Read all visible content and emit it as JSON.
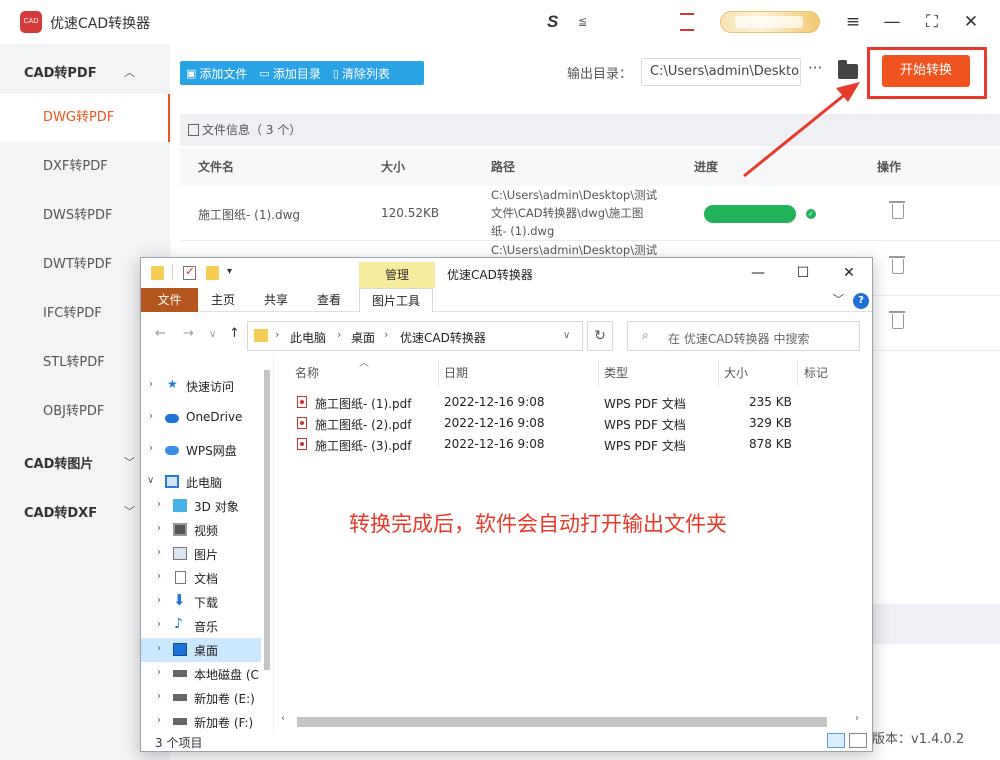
{
  "app": {
    "title": "优速CAD转换器",
    "logo_text": "CAD",
    "titlebar_mini": "≦"
  },
  "window_controls": {
    "menu": "≡",
    "minimize": "—",
    "maximize": "⛶",
    "close": "✕"
  },
  "sidebar": {
    "groups": [
      {
        "label": "CAD转PDF",
        "expanded": true
      },
      {
        "label": "CAD转图片",
        "expanded": false
      },
      {
        "label": "CAD转DXF",
        "expanded": false
      }
    ],
    "items": [
      {
        "label": "DWG转PDF",
        "active": true
      },
      {
        "label": "DXF转PDF"
      },
      {
        "label": "DWS转PDF"
      },
      {
        "label": "DWT转PDF"
      },
      {
        "label": "IFC转PDF"
      },
      {
        "label": "STL转PDF"
      },
      {
        "label": "OBJ转PDF"
      }
    ]
  },
  "toolbar": {
    "add_file": "添加文件",
    "add_dir": "添加目录",
    "clear_list": "清除列表",
    "output_label": "输出目录：",
    "output_path": "C:\\Users\\admin\\Desktop",
    "more": "···",
    "start": "开始转换"
  },
  "file_info": {
    "label": "文件信息（ 3 个）"
  },
  "table": {
    "headers": [
      "文件名",
      "大小",
      "路径",
      "进度",
      "操作"
    ],
    "rows": [
      {
        "name": "施工图纸- (1).dwg",
        "size": "120.52KB",
        "path_lines": [
          "C:\\Users\\admin\\Desktop\\测试",
          "文件\\CAD转换器\\dwg\\施工图",
          "纸- (1).dwg"
        ],
        "progress": 1.0
      },
      {
        "name": "",
        "size": "",
        "path_lines": [
          "C:\\Users\\admin\\Desktop\\测试",
          "",
          ""
        ],
        "progress": null
      },
      {
        "name": "",
        "size": "",
        "path_lines": [
          "",
          "",
          ""
        ],
        "progress": null
      }
    ]
  },
  "version": "版本：v1.4.0.2",
  "explorer": {
    "title": "优速CAD转换器",
    "manage_tab": "管理",
    "ribbon_tabs": [
      "文件",
      "主页",
      "共享",
      "查看",
      "图片工具"
    ],
    "address": [
      "此电脑",
      "桌面",
      "优速CAD转换器"
    ],
    "search_placeholder": "在 优速CAD转换器 中搜索",
    "tree": [
      {
        "label": "快速访问",
        "icon": "star-icon",
        "level": 0
      },
      {
        "label": "OneDrive",
        "icon": "cloud-icon",
        "level": 0
      },
      {
        "label": "WPS网盘",
        "icon": "cloud-icon",
        "level": 0
      },
      {
        "label": "此电脑",
        "icon": "computer-icon",
        "level": 0,
        "expanded": true
      },
      {
        "label": "3D 对象",
        "icon": "cube-icon",
        "level": 1
      },
      {
        "label": "视频",
        "icon": "video-icon",
        "level": 1
      },
      {
        "label": "图片",
        "icon": "picture-icon",
        "level": 1
      },
      {
        "label": "文档",
        "icon": "document-icon",
        "level": 1
      },
      {
        "label": "下载",
        "icon": "download-icon",
        "level": 1
      },
      {
        "label": "音乐",
        "icon": "music-icon",
        "level": 1
      },
      {
        "label": "桌面",
        "icon": "desktop-icon",
        "level": 1,
        "selected": true
      },
      {
        "label": "本地磁盘 (C",
        "icon": "drive-icon",
        "level": 1
      },
      {
        "label": "新加卷 (E:)",
        "icon": "drive-icon",
        "level": 1
      },
      {
        "label": "新加卷 (F:)",
        "icon": "drive-icon",
        "level": 1
      }
    ],
    "columns": [
      "名称",
      "日期",
      "类型",
      "大小",
      "标记"
    ],
    "files": [
      {
        "name": "施工图纸- (1).pdf",
        "date": "2022-12-16 9:08",
        "type": "WPS PDF 文档",
        "size": "235 KB"
      },
      {
        "name": "施工图纸- (2).pdf",
        "date": "2022-12-16 9:08",
        "type": "WPS PDF 文档",
        "size": "329 KB"
      },
      {
        "name": "施工图纸- (3).pdf",
        "date": "2022-12-16 9:08",
        "type": "WPS PDF 文档",
        "size": "878 KB"
      }
    ],
    "status": "3 个项目"
  },
  "annotation": "转换完成后，软件会自动打开输出文件夹",
  "colors": {
    "accent": "#f0541e",
    "toolbar_blue": "#2aa3e6",
    "progress_green": "#22b25a",
    "annotation_red": "#e8392b"
  }
}
